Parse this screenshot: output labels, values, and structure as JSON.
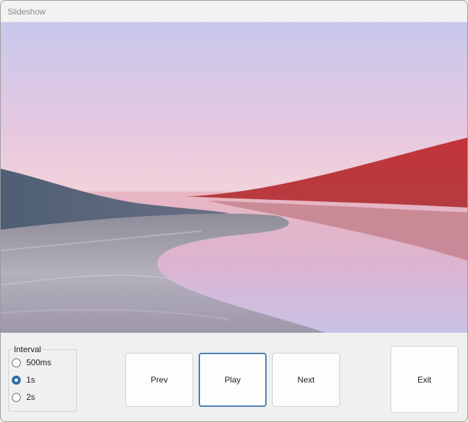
{
  "window": {
    "title": "Slideshow"
  },
  "slide": {
    "image": "landscape-with-river-and-red-hill"
  },
  "interval": {
    "legend": "Interval",
    "options": [
      {
        "label": "500ms",
        "checked": false
      },
      {
        "label": "1s",
        "checked": true
      },
      {
        "label": "2s",
        "checked": false
      }
    ]
  },
  "controls": {
    "prev_label": "Prev",
    "play_label": "Play",
    "next_label": "Next",
    "exit_label": "Exit"
  },
  "colors": {
    "accent": "#2f6aa3",
    "background": "#f0f0f0"
  }
}
